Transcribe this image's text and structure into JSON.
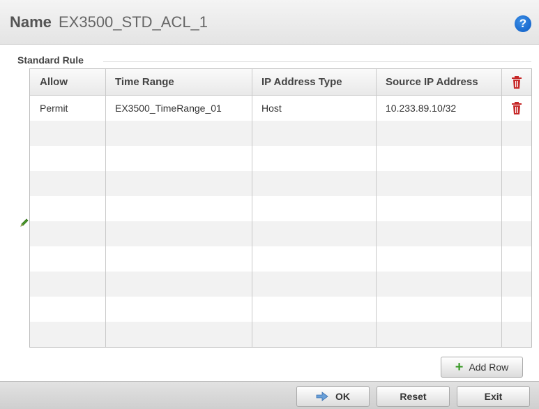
{
  "header": {
    "label": "Name",
    "value": "EX3500_STD_ACL_1",
    "help_icon": "help-icon"
  },
  "section": {
    "title": "Standard Rule"
  },
  "table": {
    "columns": [
      "Allow",
      "Time Range",
      "IP Address Type",
      "Source IP Address"
    ],
    "rows": [
      {
        "allow": "Permit",
        "time_range": "EX3500_TimeRange_01",
        "ip_address_type": "Host",
        "source_ip": "10.233.89.10/32"
      }
    ]
  },
  "buttons": {
    "add_row": "Add Row",
    "ok": "OK",
    "reset": "Reset",
    "exit": "Exit"
  },
  "colors": {
    "trash": "#c62828",
    "help": "#0a5ac4",
    "plus": "#3a9a28"
  }
}
